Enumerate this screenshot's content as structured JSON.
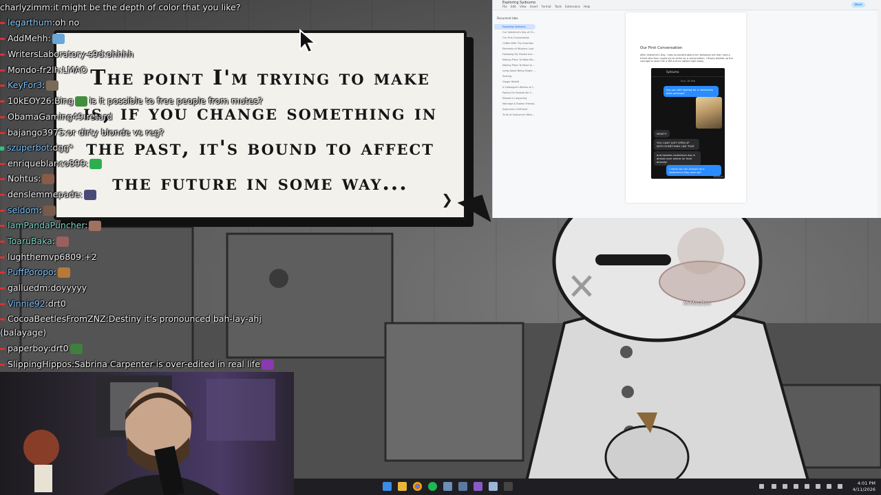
{
  "chat": [
    {
      "user": "charlyzimm",
      "text": "it might be the depth of color that you like?",
      "color": "#f0f0f0",
      "badge": "none"
    },
    {
      "user": "legarthum",
      "text": "oh no",
      "color": "#8fd0ff",
      "badge": "red"
    },
    {
      "user": "AddMehh",
      "text": "",
      "color": "#f0f0f0",
      "badge": "red",
      "emote": "#6aa6d6"
    },
    {
      "user": "WritersLaboratory-s9d",
      "text": "ohhhh",
      "color": "#f0f0f0",
      "badge": "red"
    },
    {
      "user": "Mondo-fr2lh",
      "text": "LMAO",
      "color": "#f0f0f0",
      "badge": "red"
    },
    {
      "user": "KeyFor3",
      "text": "",
      "color": "#7fc4ff",
      "badge": "red",
      "emote": "#7a6a5a"
    },
    {
      "user": "10kEOY26",
      "text": "Bing",
      "suffix": "is it possible to free people from mutes?",
      "color": "#f0f0f0",
      "badge": "red",
      "emote": "#3f8f3f"
    },
    {
      "user": "ObamaGaming49",
      "text": "retard",
      "color": "#f0f0f0",
      "badge": "red"
    },
    {
      "user": "bajango3975",
      "text": "or dirty blonde vs reg?",
      "color": "#f0f0f0",
      "badge": "red"
    },
    {
      "user": "szuperbot",
      "text": "dgg*",
      "color": "#7fc4ff",
      "badge": "green"
    },
    {
      "user": "enriqueblanco899",
      "text": "",
      "color": "#f0f0f0",
      "badge": "red",
      "emote": "#2fae4f"
    },
    {
      "user": "Nohtus",
      "text": "",
      "color": "#f0f0f0",
      "badge": "red",
      "emote": "#8a5a4a"
    },
    {
      "user": "denslemmepade",
      "text": "",
      "color": "#f0f0f0",
      "badge": "red",
      "emote": "#4a4a7a"
    },
    {
      "user": "seldom",
      "text": "",
      "color": "#7fc4ff",
      "badge": "red",
      "emote": "#7a5a4a"
    },
    {
      "user": "IamPandaPuncher",
      "text": "",
      "color": "#7fd7c4",
      "badge": "red",
      "emote": "#a07060"
    },
    {
      "user": "ToaruBaka",
      "text": "",
      "color": "#7fd7c4",
      "badge": "red",
      "emote": "#9a6060"
    },
    {
      "user": "lughthemvp6809",
      "text": "+2",
      "color": "#f0f0f0",
      "badge": "red"
    },
    {
      "user": "PuffPoropo",
      "text": "",
      "color": "#7fc4ff",
      "badge": "red",
      "emote": "#b57a3a"
    },
    {
      "user": "galluedm",
      "text": "doyyyyy",
      "color": "#f0f0f0",
      "badge": "red"
    },
    {
      "user": "Vinnie92",
      "text": "drt0",
      "color": "#7fc4ff",
      "badge": "red",
      "emote": "#555555"
    },
    {
      "user": "CocoaBeetlesFromZNZ",
      "text": "Destiny it's pronounced bah-lay-ahj",
      "color": "#f0f0f0",
      "badge": "red"
    },
    {
      "user": "",
      "text": "(balayage)",
      "color": "#f0f0f0",
      "badge": "none"
    },
    {
      "user": "paperboy",
      "text": "drt0",
      "color": "#f0f0f0",
      "badge": "red",
      "emote": "#3f7f3f"
    },
    {
      "user": "SlippingHippos",
      "text": "Sabrina Carpenter is over-edited in real life",
      "color": "#f0f0f0",
      "badge": "red",
      "emote": "#8a3ab0"
    }
  ],
  "bubble": {
    "lines": [
      "The point I'm trying to make",
      "is, if you change something in",
      "the past, it's bound to affect",
      "the future in some way..."
    ],
    "next_glyph": "❯"
  },
  "doc": {
    "title": "Exploring Sydsumo",
    "menu": [
      "File",
      "Edit",
      "View",
      "Insert",
      "Format",
      "Tools",
      "Extensions",
      "Help"
    ],
    "share": "Share",
    "outline_heading": "Document tabs",
    "outline": [
      "Exploring Sydsumo",
      "Our Valentine's Day of 20...",
      "Our First Conversation",
      "Coffee With The Guardian",
      "Elements of Wisdom: Lost",
      "Following My Private Invi...",
      "Making Plans To Make Mo...",
      "Making Plans To Move to ...",
      "Lying About Being Single ...",
      "Sexting",
      "Ginger Reddit",
      "A Colleague's Wishes of I...",
      "Paying For Sexstar-De Y...",
      "Elliasen's Lawyering",
      "Marriage & Broken Friends...",
      "Sydsumo's Girlfriend",
      "To All of Sydsumo's Wick..."
    ],
    "heading": "Our First Conversation",
    "body": "After Valentine's Day, I was so excited about him following me that I told a friend who then urged me to strike up a conversation. I finally worked up the courage to send him a DM and he replied right away.",
    "phone": {
      "contact": "Sydsumo",
      "date": "Sun, 16 Feb",
      "msg1": "Are you still looking for a valentines date perhaps?",
      "reply1": "WHAT?!",
      "reply2": "YOU CANT JUST OPEN UP WITH SOMETHING LIKE THAT",
      "reply3": "and besides valentines day is almost over where im from already!",
      "msg2": "I mean we can always do a Valentine's Day over ok?",
      "footnote": "Delivered"
    }
  },
  "cam_tag": "MrMoulton",
  "taskbar": {
    "time": "4:01 PM",
    "date": "4/11/2026"
  },
  "colors": {
    "bubble_bg": "#f3f1ec",
    "accent": "#0b57d0",
    "chat_badge_red": "#e03030"
  }
}
